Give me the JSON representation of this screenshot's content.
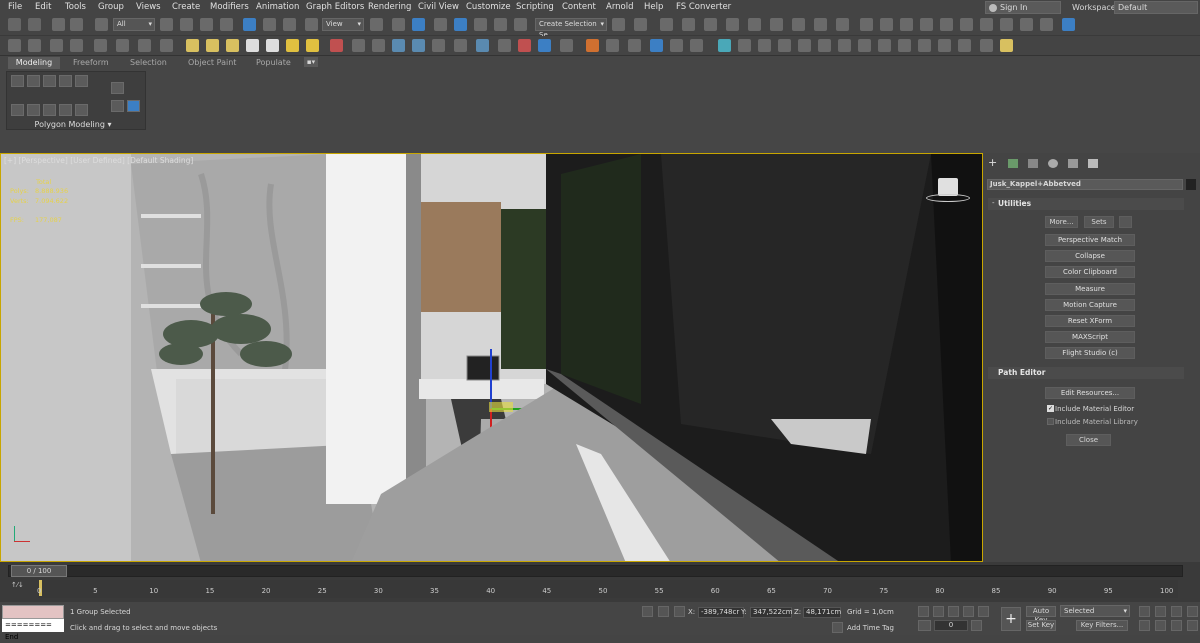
{
  "menu": [
    "File",
    "Edit",
    "Tools",
    "Group",
    "Views",
    "Create",
    "Modifiers",
    "Animation",
    "Graph Editors",
    "Rendering",
    "Civil View",
    "Customize",
    "Scripting",
    "Content",
    "Arnold",
    "Help",
    "FS Converter"
  ],
  "account": {
    "signin": "Sign In",
    "workspaces_label": "Workspaces:",
    "workspace": "Default"
  },
  "toolbar": {
    "filter": "All",
    "refcoord": "View",
    "selection_set": "Create Selection Se"
  },
  "ribbon": {
    "tabs": [
      "Modeling",
      "Freeform",
      "Selection",
      "Object Paint",
      "Populate"
    ],
    "active": "Modeling",
    "panel_label": "Polygon Modeling"
  },
  "viewport": {
    "label": "[+] [Perspective] [User Defined] [Default Shading]",
    "stats": {
      "total_label": "Total",
      "polys_label": "Polys:",
      "polys": "8.888.936",
      "verts_label": "Verts:",
      "verts": "7.094.622",
      "fps_label": "FPS:",
      "fps": "177,087"
    }
  },
  "command_panel": {
    "object_name": "Jusk_Kappel+Abbetved",
    "utilities_title": "Utilities",
    "more": "More...",
    "sets": "Sets",
    "buttons": [
      "Perspective Match",
      "Collapse",
      "Color Clipboard",
      "Measure",
      "Motion Capture",
      "Reset XForm",
      "MAXScript",
      "Flight Studio (c)"
    ],
    "path_editor_title": "Path Editor",
    "edit_resources": "Edit Resources...",
    "include_material_editor": "Include Material Editor",
    "include_material_library": "Include Material Library",
    "close": "Close"
  },
  "timeline": {
    "frame": "0 / 100",
    "ticks": [
      "0",
      "5",
      "10",
      "15",
      "20",
      "25",
      "30",
      "35",
      "40",
      "45",
      "50",
      "55",
      "60",
      "65",
      "70",
      "75",
      "80",
      "85",
      "90",
      "95",
      "100"
    ]
  },
  "status": {
    "maxscript": "======== End",
    "selection": "1 Group Selected",
    "prompt": "Click and drag to select and move objects",
    "x_label": "X:",
    "x": "-389,748cr",
    "y_label": "Y:",
    "y": "347,522cm",
    "z_label": "Z:",
    "z": "48,171cm",
    "grid": "Grid = 1,0cm",
    "add_time_tag": "Add Time Tag",
    "autokey": "Auto Key",
    "selected": "Selected",
    "setkey": "Set Key",
    "keyfilters": "Key Filters...",
    "frame_value": "0"
  },
  "colors": {
    "accent": "#c8a600",
    "highlight_btn": "#3c7fc4"
  }
}
